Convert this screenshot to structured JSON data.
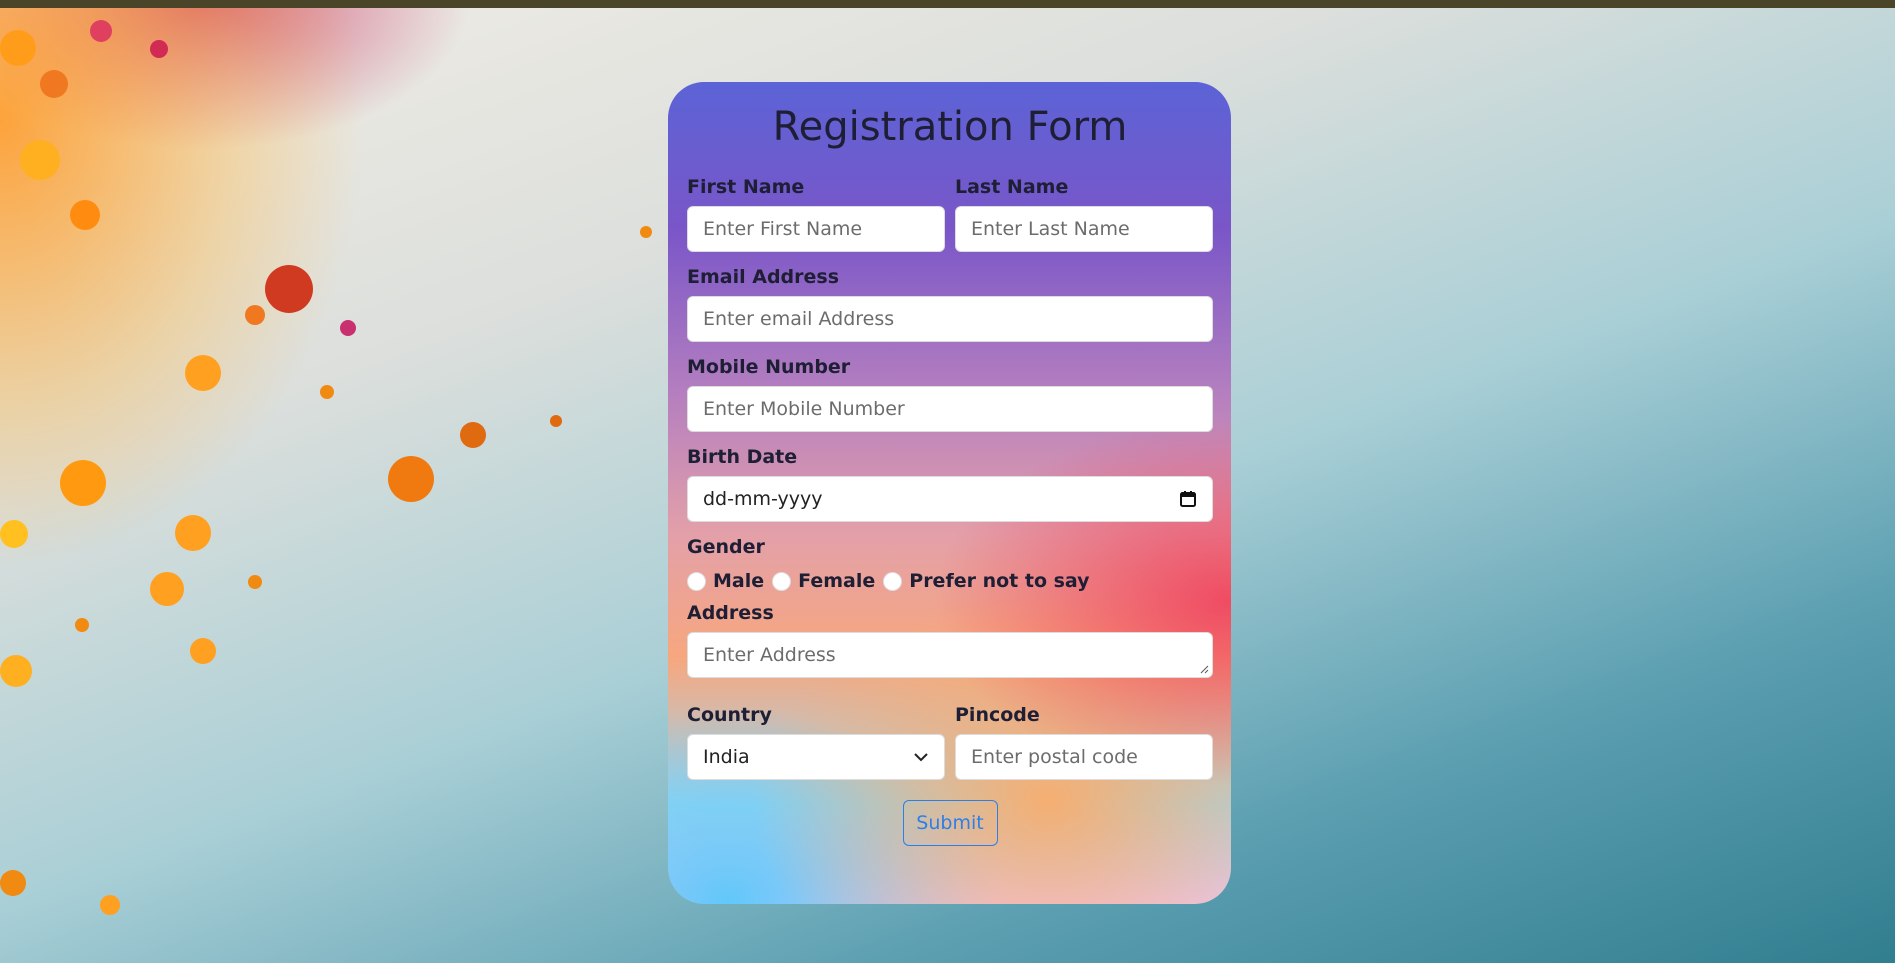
{
  "form": {
    "title": "Registration Form",
    "first_name": {
      "label": "First Name",
      "placeholder": "Enter First Name"
    },
    "last_name": {
      "label": "Last Name",
      "placeholder": "Enter Last Name"
    },
    "email": {
      "label": "Email Address",
      "placeholder": "Enter email Address"
    },
    "mobile": {
      "label": "Mobile Number",
      "placeholder": "Enter Mobile Number"
    },
    "birth_date": {
      "label": "Birth Date",
      "placeholder": "dd-mm-yyyy",
      "icon": "calendar-icon"
    },
    "gender": {
      "label": "Gender",
      "options": [
        "Male",
        "Female",
        "Prefer not to say"
      ]
    },
    "address": {
      "label": "Address",
      "placeholder": "Enter Address"
    },
    "country": {
      "label": "Country",
      "value": "India",
      "icon": "chevron-down-icon"
    },
    "pincode": {
      "label": "Pincode",
      "placeholder": "Enter postal code"
    },
    "submit_label": "Submit"
  },
  "colors": {
    "submit_accent": "#2d7fe8",
    "label_text": "#1e1e35",
    "top_bar": "#4a4529"
  }
}
